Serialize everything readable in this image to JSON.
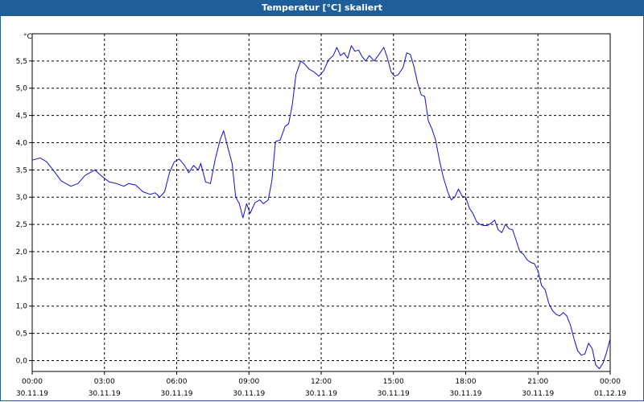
{
  "window": {
    "title": "Temperatur [°C] skaliert"
  },
  "chart_data": {
    "type": "line",
    "title": "Temperatur [°C] skaliert",
    "ylabel": "°C",
    "xlabel": "",
    "grid": true,
    "ylim": [
      -0.2,
      6.0
    ],
    "xlim": [
      0,
      24
    ],
    "y_ticks": [
      "0,0",
      "0,5",
      "1,0",
      "1,5",
      "2,0",
      "2,5",
      "3,0",
      "3,5",
      "4,0",
      "4,5",
      "5,0",
      "5,5"
    ],
    "x_ticks": [
      {
        "time": "00:00",
        "date": "30.11.19"
      },
      {
        "time": "03:00",
        "date": "30.11.19"
      },
      {
        "time": "06:00",
        "date": "30.11.19"
      },
      {
        "time": "09:00",
        "date": "30.11.19"
      },
      {
        "time": "12:00",
        "date": "30.11.19"
      },
      {
        "time": "15:00",
        "date": "30.11.19"
      },
      {
        "time": "18:00",
        "date": "30.11.19"
      },
      {
        "time": "21:00",
        "date": "30.11.19"
      },
      {
        "time": "00:00",
        "date": "01.12.19"
      }
    ],
    "series": [
      {
        "color": "#1010cc",
        "points": [
          [
            0.0,
            3.68
          ],
          [
            0.33,
            3.72
          ],
          [
            0.6,
            3.65
          ],
          [
            0.9,
            3.48
          ],
          [
            1.2,
            3.3
          ],
          [
            1.6,
            3.2
          ],
          [
            1.9,
            3.25
          ],
          [
            2.2,
            3.4
          ],
          [
            2.6,
            3.5
          ],
          [
            2.9,
            3.38
          ],
          [
            3.2,
            3.28
          ],
          [
            3.5,
            3.25
          ],
          [
            3.8,
            3.2
          ],
          [
            4.0,
            3.25
          ],
          [
            4.3,
            3.22
          ],
          [
            4.6,
            3.1
          ],
          [
            4.9,
            3.05
          ],
          [
            5.1,
            3.08
          ],
          [
            5.3,
            3.0
          ],
          [
            5.5,
            3.1
          ],
          [
            5.7,
            3.45
          ],
          [
            5.9,
            3.65
          ],
          [
            6.1,
            3.7
          ],
          [
            6.3,
            3.6
          ],
          [
            6.5,
            3.45
          ],
          [
            6.7,
            3.58
          ],
          [
            6.9,
            3.5
          ],
          [
            7.0,
            3.62
          ],
          [
            7.2,
            3.28
          ],
          [
            7.4,
            3.25
          ],
          [
            7.6,
            3.7
          ],
          [
            7.8,
            4.05
          ],
          [
            7.95,
            4.22
          ],
          [
            8.1,
            3.95
          ],
          [
            8.3,
            3.62
          ],
          [
            8.45,
            3.0
          ],
          [
            8.6,
            2.88
          ],
          [
            8.75,
            2.62
          ],
          [
            8.9,
            2.88
          ],
          [
            9.05,
            2.7
          ],
          [
            9.25,
            2.9
          ],
          [
            9.45,
            2.95
          ],
          [
            9.6,
            2.88
          ],
          [
            9.8,
            2.95
          ],
          [
            9.95,
            3.3
          ],
          [
            10.1,
            4.02
          ],
          [
            10.3,
            4.05
          ],
          [
            10.5,
            4.3
          ],
          [
            10.65,
            4.35
          ],
          [
            10.8,
            4.7
          ],
          [
            10.95,
            5.25
          ],
          [
            11.15,
            5.5
          ],
          [
            11.3,
            5.45
          ],
          [
            11.5,
            5.35
          ],
          [
            11.7,
            5.3
          ],
          [
            11.9,
            5.22
          ],
          [
            12.1,
            5.32
          ],
          [
            12.3,
            5.52
          ],
          [
            12.5,
            5.6
          ],
          [
            12.65,
            5.75
          ],
          [
            12.8,
            5.6
          ],
          [
            12.95,
            5.65
          ],
          [
            13.1,
            5.55
          ],
          [
            13.25,
            5.78
          ],
          [
            13.4,
            5.68
          ],
          [
            13.55,
            5.7
          ],
          [
            13.7,
            5.58
          ],
          [
            13.85,
            5.5
          ],
          [
            14.0,
            5.6
          ],
          [
            14.2,
            5.5
          ],
          [
            14.4,
            5.62
          ],
          [
            14.6,
            5.75
          ],
          [
            14.75,
            5.55
          ],
          [
            14.9,
            5.3
          ],
          [
            15.05,
            5.22
          ],
          [
            15.2,
            5.25
          ],
          [
            15.4,
            5.38
          ],
          [
            15.55,
            5.65
          ],
          [
            15.7,
            5.62
          ],
          [
            15.85,
            5.4
          ],
          [
            16.0,
            5.1
          ],
          [
            16.15,
            4.88
          ],
          [
            16.3,
            4.85
          ],
          [
            16.45,
            4.4
          ],
          [
            16.6,
            4.25
          ],
          [
            16.75,
            4.05
          ],
          [
            16.9,
            3.7
          ],
          [
            17.05,
            3.4
          ],
          [
            17.25,
            3.1
          ],
          [
            17.4,
            2.95
          ],
          [
            17.55,
            3.0
          ],
          [
            17.7,
            3.15
          ],
          [
            17.85,
            3.02
          ],
          [
            18.0,
            3.0
          ],
          [
            18.15,
            2.8
          ],
          [
            18.3,
            2.7
          ],
          [
            18.45,
            2.55
          ],
          [
            18.6,
            2.5
          ],
          [
            18.75,
            2.48
          ],
          [
            18.9,
            2.48
          ],
          [
            19.05,
            2.52
          ],
          [
            19.2,
            2.58
          ],
          [
            19.35,
            2.4
          ],
          [
            19.5,
            2.35
          ],
          [
            19.65,
            2.5
          ],
          [
            19.8,
            2.42
          ],
          [
            19.95,
            2.4
          ],
          [
            20.1,
            2.2
          ],
          [
            20.25,
            2.0
          ],
          [
            20.4,
            1.95
          ],
          [
            20.55,
            1.85
          ],
          [
            20.7,
            1.8
          ],
          [
            20.85,
            1.78
          ],
          [
            21.0,
            1.65
          ],
          [
            21.15,
            1.38
          ],
          [
            21.3,
            1.3
          ],
          [
            21.45,
            1.05
          ],
          [
            21.6,
            0.92
          ],
          [
            21.75,
            0.85
          ],
          [
            21.9,
            0.82
          ],
          [
            22.05,
            0.88
          ],
          [
            22.2,
            0.82
          ],
          [
            22.35,
            0.65
          ],
          [
            22.5,
            0.4
          ],
          [
            22.65,
            0.18
          ],
          [
            22.8,
            0.1
          ],
          [
            22.95,
            0.12
          ],
          [
            23.1,
            0.32
          ],
          [
            23.25,
            0.22
          ],
          [
            23.4,
            -0.08
          ],
          [
            23.55,
            -0.15
          ],
          [
            23.7,
            -0.05
          ],
          [
            23.85,
            0.15
          ],
          [
            24.0,
            0.4
          ]
        ]
      }
    ]
  }
}
